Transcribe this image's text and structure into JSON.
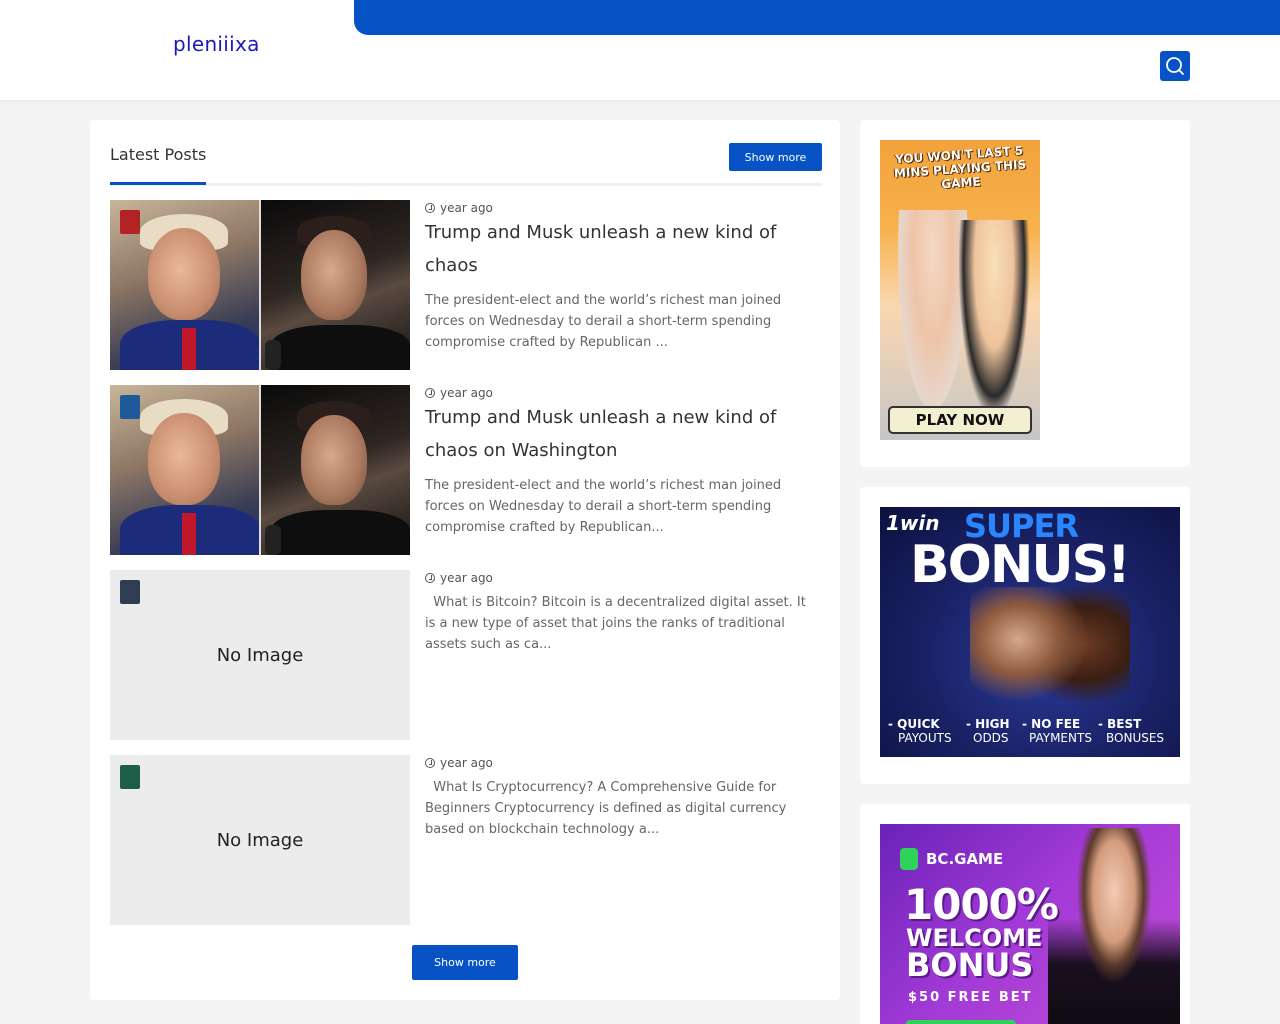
{
  "header": {
    "site_title": "pleniiixa",
    "brand_color": "#0753c6",
    "search_icon": "search-icon"
  },
  "latest": {
    "section_title": "Latest Posts",
    "show_more_label": "Show more",
    "posts": [
      {
        "badge_color": "#b22222",
        "has_image": true,
        "time": "year ago",
        "title": "Trump and Musk unleash a new kind of chaos",
        "excerpt": "The president-elect and the world’s richest man joined forces on Wednesday to derail a short-term spending compromise crafted by Republican ..."
      },
      {
        "badge_color": "#1e5a9a",
        "has_image": true,
        "time": "year ago",
        "title": "Trump and Musk unleash a new kind of chaos on Washington",
        "excerpt": "The president-elect and the world’s richest man joined forces on Wednesday to derail a short-term spending compromise crafted by Republican..."
      },
      {
        "badge_color": "#2c3e50",
        "has_image": false,
        "no_image_label": "No Image",
        "time": "year ago",
        "title": "",
        "excerpt": "  What is Bitcoin? Bitcoin is a decentralized digital asset. It is a new type of asset that joins the ranks of traditional assets such as ca..."
      },
      {
        "badge_color": "#1e5e48",
        "has_image": false,
        "no_image_label": "No Image",
        "time": "year ago",
        "title": "",
        "excerpt": "  What Is Cryptocurrency? A Comprehensive Guide for Beginners Cryptocurrency is defined as digital currency based on blockchain technology a..."
      }
    ]
  },
  "sidebar": {
    "ad1": {
      "headline": "YOU WON'T LAST 5 MINS PLAYING THIS GAME",
      "cta": "PLAY NOW"
    },
    "ad2": {
      "logo": "1win",
      "super": "SUPER",
      "bonus": "BONUS!",
      "features": [
        {
          "line1": "- QUICK",
          "line2": "PAYOUTS"
        },
        {
          "line1": "- HIGH",
          "line2": "ODDS"
        },
        {
          "line1": "- NO FEE",
          "line2": "PAYMENTS"
        },
        {
          "line1": "- BEST",
          "line2": "BONUSES"
        }
      ]
    },
    "ad3": {
      "logo": "BC.GAME",
      "big": "1000%",
      "welcome": "WELCOME",
      "bonus": "BONUS",
      "free_bet": "$50 FREE BET"
    }
  }
}
